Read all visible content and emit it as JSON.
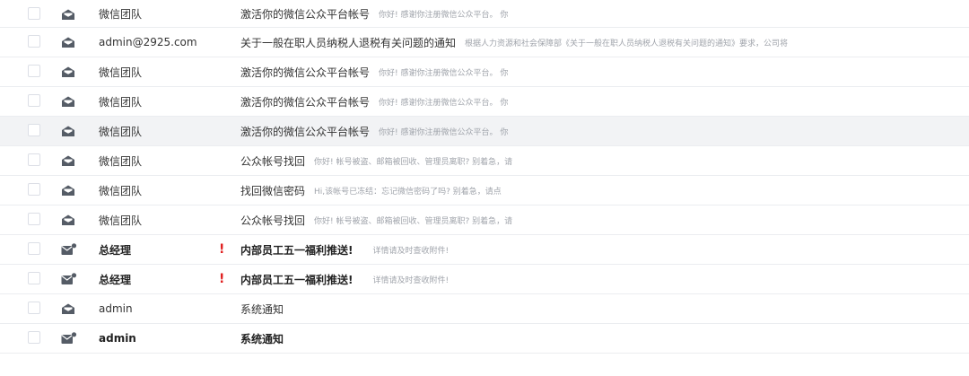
{
  "colors": {
    "flag": "#e02020",
    "preview": "#a0a4ab",
    "divider": "#ebedf0",
    "hover": "#f2f3f5",
    "icon": "#555c66"
  },
  "rows": [
    {
      "sender": "微信团队",
      "subject": "激活你的微信公众平台帐号",
      "preview": "你好! 感谢你注册微信公众平台。 你",
      "icon": "envelope-open-icon",
      "unread": false,
      "important": false,
      "hover": false
    },
    {
      "sender": "admin@2925.com",
      "subject": "关于一般在职人员纳税人退税有关问题的通知",
      "preview": "根据人力资源和社会保障部《关于一般在职人员纳税人退税有关问题的通知》要求，公司将",
      "icon": "envelope-open-icon",
      "unread": false,
      "important": false,
      "hover": false
    },
    {
      "sender": "微信团队",
      "subject": "激活你的微信公众平台帐号",
      "preview": "你好! 感谢你注册微信公众平台。 你",
      "icon": "envelope-open-icon",
      "unread": false,
      "important": false,
      "hover": false
    },
    {
      "sender": "微信团队",
      "subject": "激活你的微信公众平台帐号",
      "preview": "你好! 感谢你注册微信公众平台。 你",
      "icon": "envelope-open-icon",
      "unread": false,
      "important": false,
      "hover": false
    },
    {
      "sender": "微信团队",
      "subject": "激活你的微信公众平台帐号",
      "preview": "你好! 感谢你注册微信公众平台。 你",
      "icon": "envelope-open-icon",
      "unread": false,
      "important": false,
      "hover": true
    },
    {
      "sender": "微信团队",
      "subject": "公众帐号找回",
      "preview": "你好! 帐号被盗、邮箱被回收、管理员离职? 别着急，请",
      "icon": "envelope-open-icon",
      "unread": false,
      "important": false,
      "hover": false
    },
    {
      "sender": "微信团队",
      "subject": "找回微信密码",
      "preview": "Hi,该帐号已冻结：忘记微信密码了吗? 别着急，请点",
      "icon": "envelope-open-icon",
      "unread": false,
      "important": false,
      "hover": false
    },
    {
      "sender": "微信团队",
      "subject": "公众帐号找回",
      "preview": "你好! 帐号被盗、邮箱被回收、管理员离职? 别着急，请",
      "icon": "envelope-open-icon",
      "unread": false,
      "important": false,
      "hover": false
    },
    {
      "sender": "总经理",
      "subject": "内部员工五一福利推送!",
      "preview": "详情请及时查收附件!",
      "icon": "envelope-unread-icon",
      "unread": true,
      "important": true,
      "hover": false
    },
    {
      "sender": "总经理",
      "subject": "内部员工五一福利推送!",
      "preview": "详情请及时查收附件!",
      "icon": "envelope-unread-icon",
      "unread": true,
      "important": true,
      "hover": false
    },
    {
      "sender": "admin",
      "subject": "系统通知",
      "preview": "",
      "icon": "envelope-open-icon",
      "unread": false,
      "important": false,
      "hover": false
    },
    {
      "sender": "admin",
      "subject": "系统通知",
      "preview": "",
      "icon": "envelope-unread-icon",
      "unread": true,
      "important": false,
      "hover": false
    }
  ],
  "flag_symbol": "!"
}
